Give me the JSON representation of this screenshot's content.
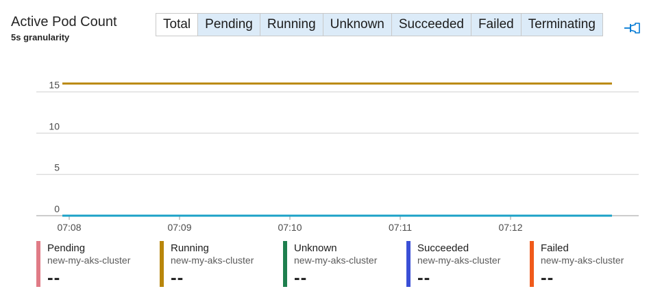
{
  "header": {
    "title": "Active Pod Count",
    "subtitle": "5s granularity"
  },
  "tabs": [
    {
      "label": "Total",
      "active": true
    },
    {
      "label": "Pending",
      "active": false
    },
    {
      "label": "Running",
      "active": false
    },
    {
      "label": "Unknown",
      "active": false
    },
    {
      "label": "Succeeded",
      "active": false
    },
    {
      "label": "Failed",
      "active": false
    },
    {
      "label": "Terminating",
      "active": false
    }
  ],
  "pin_icon": "pin-icon",
  "colors": {
    "accent": "#0078d4",
    "running": "#b8860b",
    "baseline": "#1ba1c7",
    "pending": "#e07b86",
    "unknown": "#1e7f4e",
    "succeeded": "#3a4fd6",
    "failed": "#f05a1a"
  },
  "chart_data": {
    "type": "line",
    "title": "Active Pod Count",
    "subtitle": "5s granularity",
    "x_ticks": [
      "07:08",
      "07:09",
      "07:10",
      "07:11",
      "07:12"
    ],
    "x_range": [
      "07:08",
      "07:12:55"
    ],
    "ylim": [
      0,
      17
    ],
    "y_ticks": [
      0,
      5,
      10,
      15
    ],
    "grid": true,
    "series": [
      {
        "name": "Running",
        "color": "#b8860b",
        "x": [
          "07:08",
          "07:12:55"
        ],
        "values": [
          16,
          16
        ]
      },
      {
        "name": "Pending",
        "color": "#1ba1c7",
        "x": [
          "07:08",
          "07:12:55"
        ],
        "values": [
          0,
          0
        ]
      }
    ]
  },
  "legend": [
    {
      "name": "Pending",
      "source": "new-my-aks-cluster",
      "value": "--",
      "color": "#e07b86"
    },
    {
      "name": "Running",
      "source": "new-my-aks-cluster",
      "value": "--",
      "color": "#b8860b"
    },
    {
      "name": "Unknown",
      "source": "new-my-aks-cluster",
      "value": "--",
      "color": "#1e7f4e"
    },
    {
      "name": "Succeeded",
      "source": "new-my-aks-cluster",
      "value": "--",
      "color": "#3a4fd6"
    },
    {
      "name": "Failed",
      "source": "new-my-aks-cluster",
      "value": "--",
      "color": "#f05a1a"
    }
  ]
}
